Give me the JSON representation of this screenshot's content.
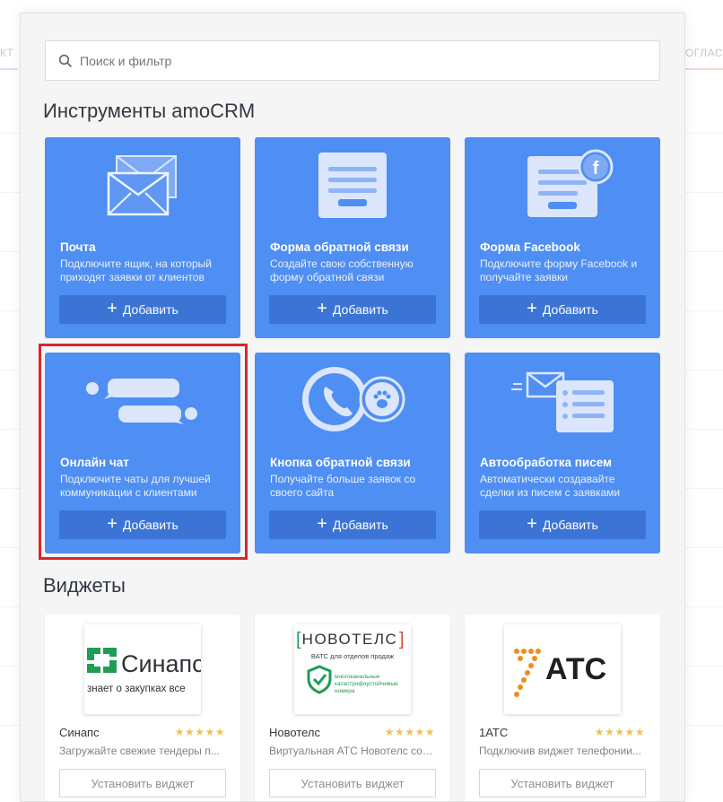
{
  "background": {
    "left_edge_text": "КТ",
    "right_edge_text": "СОГЛАС"
  },
  "search": {
    "placeholder": "Поиск и фильтр",
    "icon": "search-icon"
  },
  "sections": {
    "tools_title": "Инструменты amoCRM",
    "widgets_title": "Виджеты"
  },
  "tools": [
    {
      "title": "Почта",
      "description": "Подключите ящик, на который приходят заявки от клиентов",
      "button": "Добавить",
      "icon": "mail-envelopes-icon"
    },
    {
      "title": "Форма обратной связи",
      "description": "Создайте свою собственную форму обратной связи",
      "button": "Добавить",
      "icon": "form-icon"
    },
    {
      "title": "Форма Facebook",
      "description": "Подключите форму Facebook и получайте заявки",
      "button": "Добавить",
      "icon": "facebook-form-icon"
    },
    {
      "title": "Онлайн чат",
      "description": "Подключите чаты для лучшей коммуникации с клиентами",
      "button": "Добавить",
      "icon": "chat-bubbles-icon"
    },
    {
      "title": "Кнопка обратной связи",
      "description": "Получайте больше заявок со своего сайта",
      "button": "Добавить",
      "icon": "callback-phone-icon"
    },
    {
      "title": "Автообработка писем",
      "description": "Автоматически создавайте сделки из писем с заявками",
      "button": "Добавить",
      "icon": "mail-to-list-icon"
    }
  ],
  "widgets": [
    {
      "name": "Синапс",
      "description": "Загружайте свежие тендеры п...",
      "rating": "★★★★★",
      "button": "Установить виджет",
      "logo": {
        "brand": "Синапс",
        "tagline": "знает о закупках все"
      }
    },
    {
      "name": "Новотелс",
      "description": "Виртуальная АТС Новотелс соз...",
      "rating": "★★★★★",
      "button": "Установить виджет",
      "logo": {
        "brand": "НОВОТЕЛС",
        "tagline": "ВАТС для отделов продаж",
        "note": "многоканальные катастрофоустойчивые номера"
      }
    },
    {
      "name": "1АТС",
      "description": "Подключив виджет телефонии...",
      "rating": "★★★★★",
      "button": "Установить виджет",
      "logo": {
        "brand": "АТС"
      }
    }
  ],
  "colors": {
    "tile": "#4f8ef2",
    "tile_button": "#3c74d6",
    "highlight": "#d9262b",
    "stars": "#f2c34b"
  }
}
